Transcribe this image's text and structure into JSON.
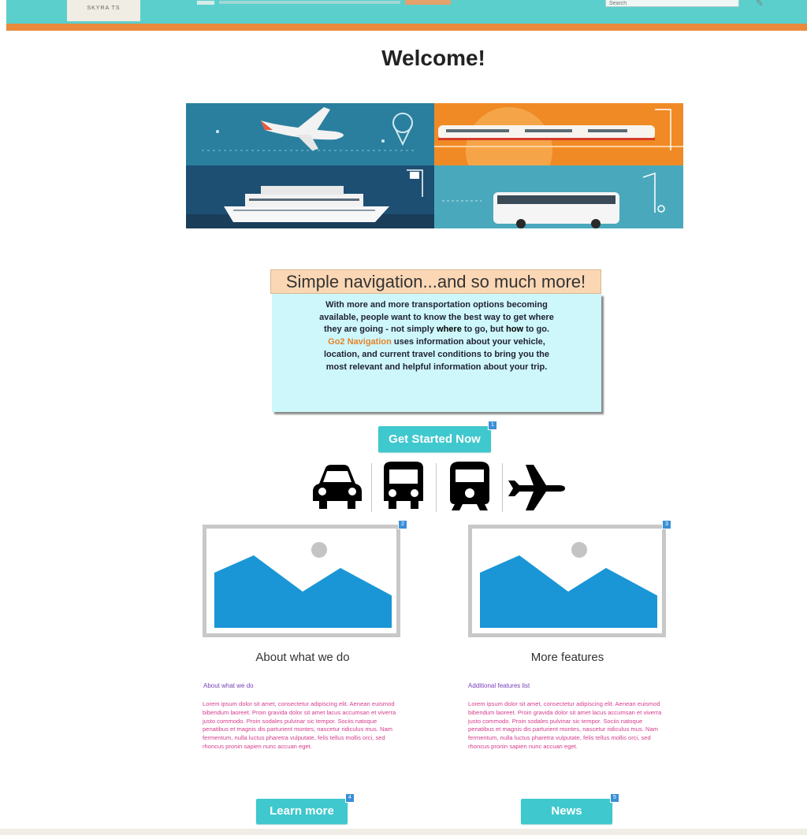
{
  "header": {
    "logo_text": "SKYRA TS",
    "search_placeholder": "Search",
    "search_icon": "pencil-icon"
  },
  "page": {
    "title": "Welcome!"
  },
  "info": {
    "heading": "Simple navigation...and so much more!",
    "text_before_where": "With more and more transportation options becoming available, people want to know the best way to get where they are going - not simply ",
    "where": "where",
    "text_between": " to go, but ",
    "how": "how",
    "text_after_how": " to go. ",
    "brand": "Go2 Navigation",
    "text_after_brand": " uses information about your vehicle, location, and current travel conditions to bring you the most relevant and helpful information about your trip."
  },
  "cta": {
    "label": "Get Started Now",
    "badge": "1"
  },
  "transport_icons": [
    "car-icon",
    "bus-icon",
    "train-icon",
    "airplane-icon"
  ],
  "columns": [
    {
      "image_badge": "2",
      "title": "About what we do",
      "subtitle": "About what we do",
      "body": "Lorem ipsum dolor sit amet, consectetur adipiscing elit. Aenean euismod bibendum laoreet. Proin gravida dolor sit amet lacus accumsan et viverra justo commodo. Proin sodales pulvinar sic tempor. Sociis natoque penatibus et magnis dis parturient montes, nascetur ridiculus mus. Nam fermentum, nulla luctus pharetra vulputate, felis tellus mollis orci, sed rhoncus pronin sapien nunc accuan eget.",
      "button_label": "Learn more",
      "button_badge": "4"
    },
    {
      "image_badge": "3",
      "title": "More features",
      "subtitle": "Additional features list",
      "body": "Lorem ipsum dolor sit amet, consectetur adipiscing elit. Aenean euismod bibendum laoreet. Proin gravida dolor sit amet lacus accumsan et viverra justo commodo. Proin sodales pulvinar sic tempor. Sociis natoque penatibus et magnis dis parturient montes, nascetur ridiculus mus. Nam fermentum, nulla luctus pharetra vulputate, felis tellus mollis orci, sed rhoncus pronin sapien nunc accuan eget.",
      "button_label": "News",
      "button_badge": "5"
    }
  ],
  "colors": {
    "topbar": "#5bcfcc",
    "accent_stripe": "#e98a3c",
    "button": "#3fc8cd",
    "info_heading_bg": "#fbd7b5",
    "info_body_bg": "#cdf7fa",
    "brand_text": "#e6832b"
  }
}
